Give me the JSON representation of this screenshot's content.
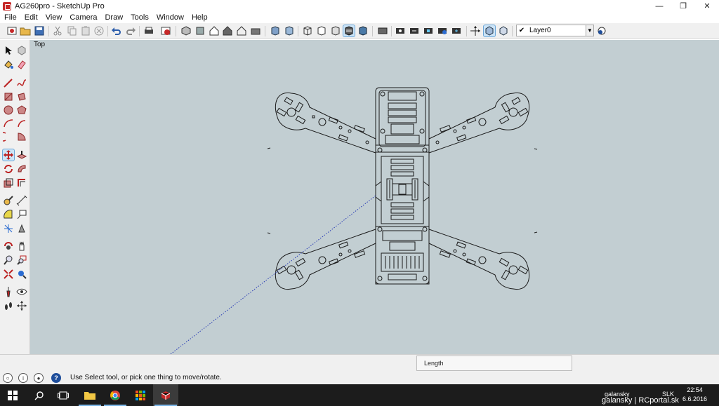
{
  "window": {
    "title": "AG260pro - SketchUp Pro",
    "controls": {
      "minimize": "—",
      "maximize": "❐",
      "close": "✕"
    }
  },
  "menu": [
    "File",
    "Edit",
    "View",
    "Camera",
    "Draw",
    "Tools",
    "Window",
    "Help"
  ],
  "toolbar": {
    "layer": {
      "check": "✔",
      "value": "Layer0",
      "dropdown": "▼"
    }
  },
  "viewport": {
    "view_name": "Top",
    "background": "#c2ced2"
  },
  "status": {
    "message": "Use Select tool, or pick one thing to move/rotate.",
    "vcb_label": "Length",
    "help_glyph": "?",
    "icons": [
      "geo-icon",
      "info-icon",
      "user-icon"
    ]
  },
  "taskbar": {
    "tray_user": "galansky",
    "tray_lang": "SLK",
    "time": "22:54",
    "date": "6.6.2016",
    "watermark": "galansky | RCportal.sk"
  }
}
